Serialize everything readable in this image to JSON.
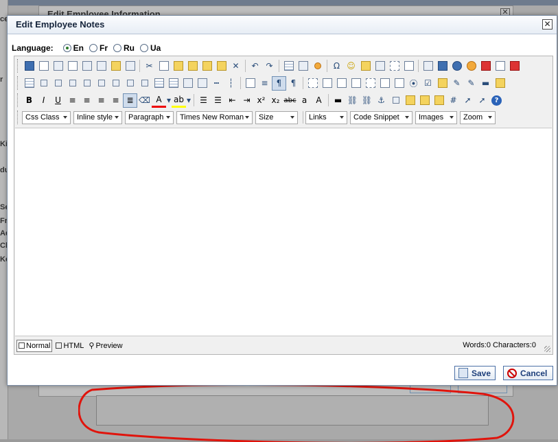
{
  "background": {
    "dialog_title": "Edit Employee Information",
    "close_glyph": "✕",
    "left_labels": [
      "ce",
      "r",
      "Ki",
      "du",
      "Se",
      "Fr",
      "Ad",
      "Ch",
      "Ke"
    ]
  },
  "dialog": {
    "title": "Edit Employee Notes",
    "close_glyph": "✕"
  },
  "language": {
    "label": "Language:",
    "options": [
      {
        "label": "En",
        "selected": true
      },
      {
        "label": "Fr",
        "selected": false
      },
      {
        "label": "Ru",
        "selected": false
      },
      {
        "label": "Ua",
        "selected": false
      }
    ]
  },
  "toolbar": {
    "bold": "B",
    "italic": "I",
    "underline": "U",
    "special_char": "Ω",
    "undo": "↶",
    "redo": "↷",
    "superscript": "x²",
    "subscript": "x₂",
    "strike": "abc",
    "font_color": "A",
    "help": "?",
    "smiley": "☺",
    "cut": "✂",
    "dropdowns": {
      "css_class": "Css Class",
      "inline_style": "Inline style",
      "paragraph": "Paragraph",
      "font": "Times New Roman",
      "size": "Size",
      "links": "Links",
      "code_snippet": "Code Snippet",
      "images": "Images",
      "zoom": "Zoom"
    }
  },
  "status": {
    "modes": [
      "Normal",
      "HTML",
      "Preview"
    ],
    "active_mode": "Normal",
    "counter": "Words:0 Characters:0"
  },
  "buttons": {
    "save": "Save",
    "cancel": "Cancel"
  },
  "colors": {
    "annotation": "#e0140c",
    "title_text": "#15243b",
    "button_text": "#1d3e7a"
  }
}
